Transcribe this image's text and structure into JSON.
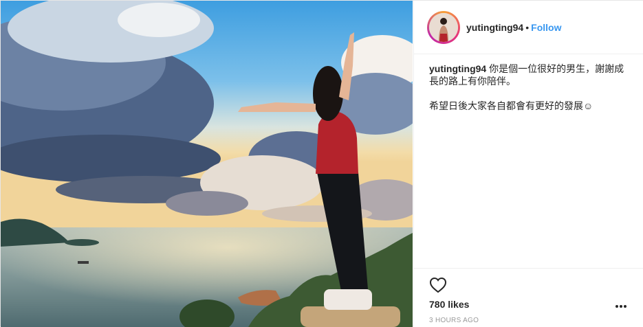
{
  "post": {
    "username": "yutingting94",
    "separator": "•",
    "follow_label": "Follow",
    "caption": {
      "username": "yutingting94",
      "line1": "你是個一位很好的男生，謝謝成長的路上有你陪伴。",
      "line2": "希望日後大家各自都會有更好的發展☺"
    },
    "likes": "780 likes",
    "timestamp": "3 HOURS AGO"
  },
  "icons": {
    "like": "heart-icon",
    "more": "more-options-icon"
  },
  "colors": {
    "follow": "#3897f0",
    "text": "#262626",
    "muted": "#999999",
    "divider": "#efefef",
    "avatar_ring": [
      "#f7a13a",
      "#e6367a",
      "#c02aa8"
    ]
  }
}
